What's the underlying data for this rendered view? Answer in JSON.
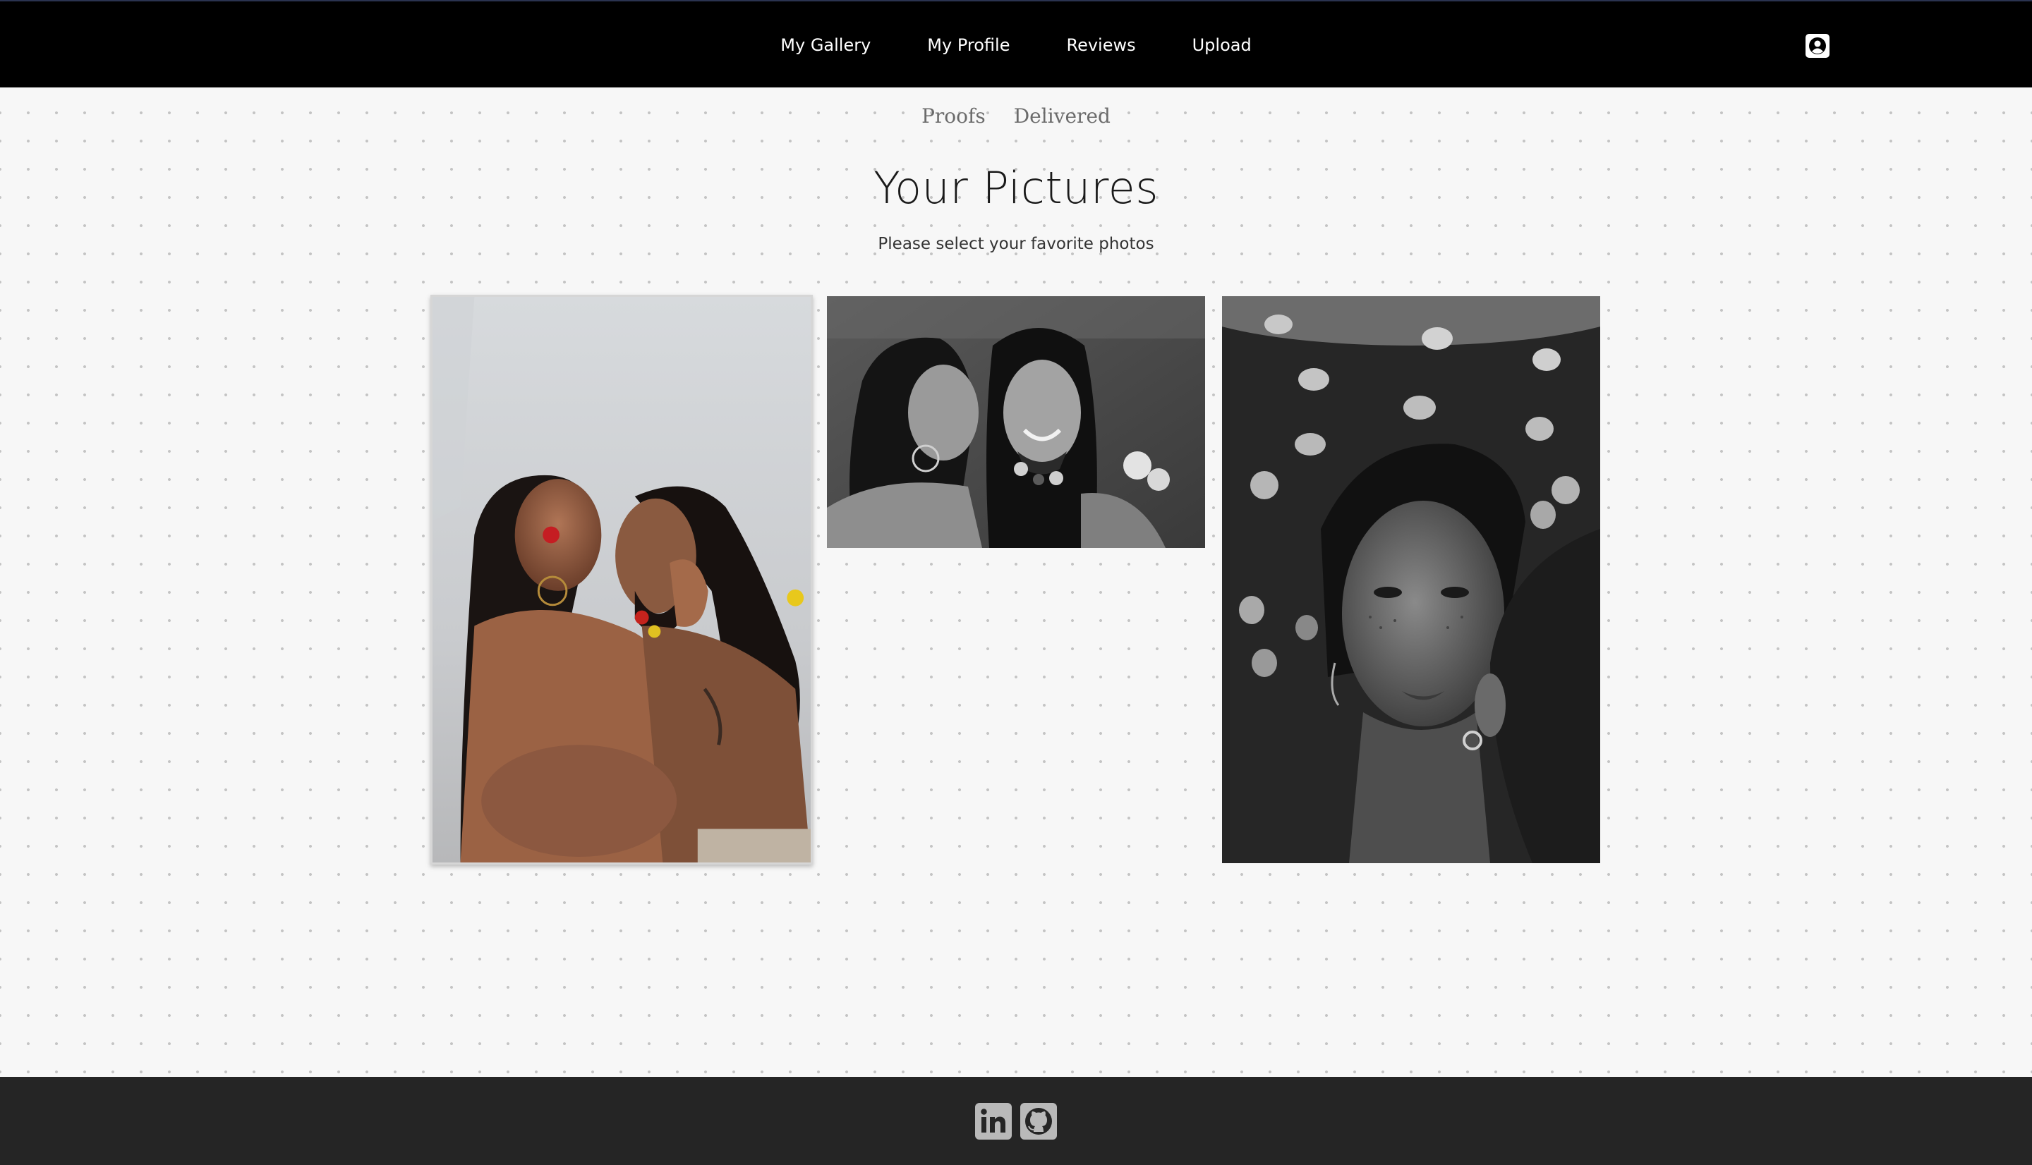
{
  "nav": {
    "items": [
      {
        "label": "My Gallery"
      },
      {
        "label": "My Profile"
      },
      {
        "label": "Reviews"
      },
      {
        "label": "Upload"
      }
    ],
    "profile_icon": "user-circle-icon"
  },
  "subnav": {
    "proofs_label": "Proofs",
    "delivered_label": "Delivered"
  },
  "main": {
    "title": "Your Pictures",
    "subtitle": "Please select your favorite photos"
  },
  "gallery": {
    "photos": [
      {
        "icon": "photo-couple-kissing-color"
      },
      {
        "icon": "photo-couple-smiling-bw"
      },
      {
        "icon": "photo-portrait-woman-bw"
      }
    ]
  },
  "footer": {
    "icons": [
      "linkedin-icon",
      "github-icon"
    ]
  },
  "colors": {
    "navbar_bg": "#000000",
    "page_bg": "#f7f7f7",
    "footer_bg": "#252525"
  }
}
